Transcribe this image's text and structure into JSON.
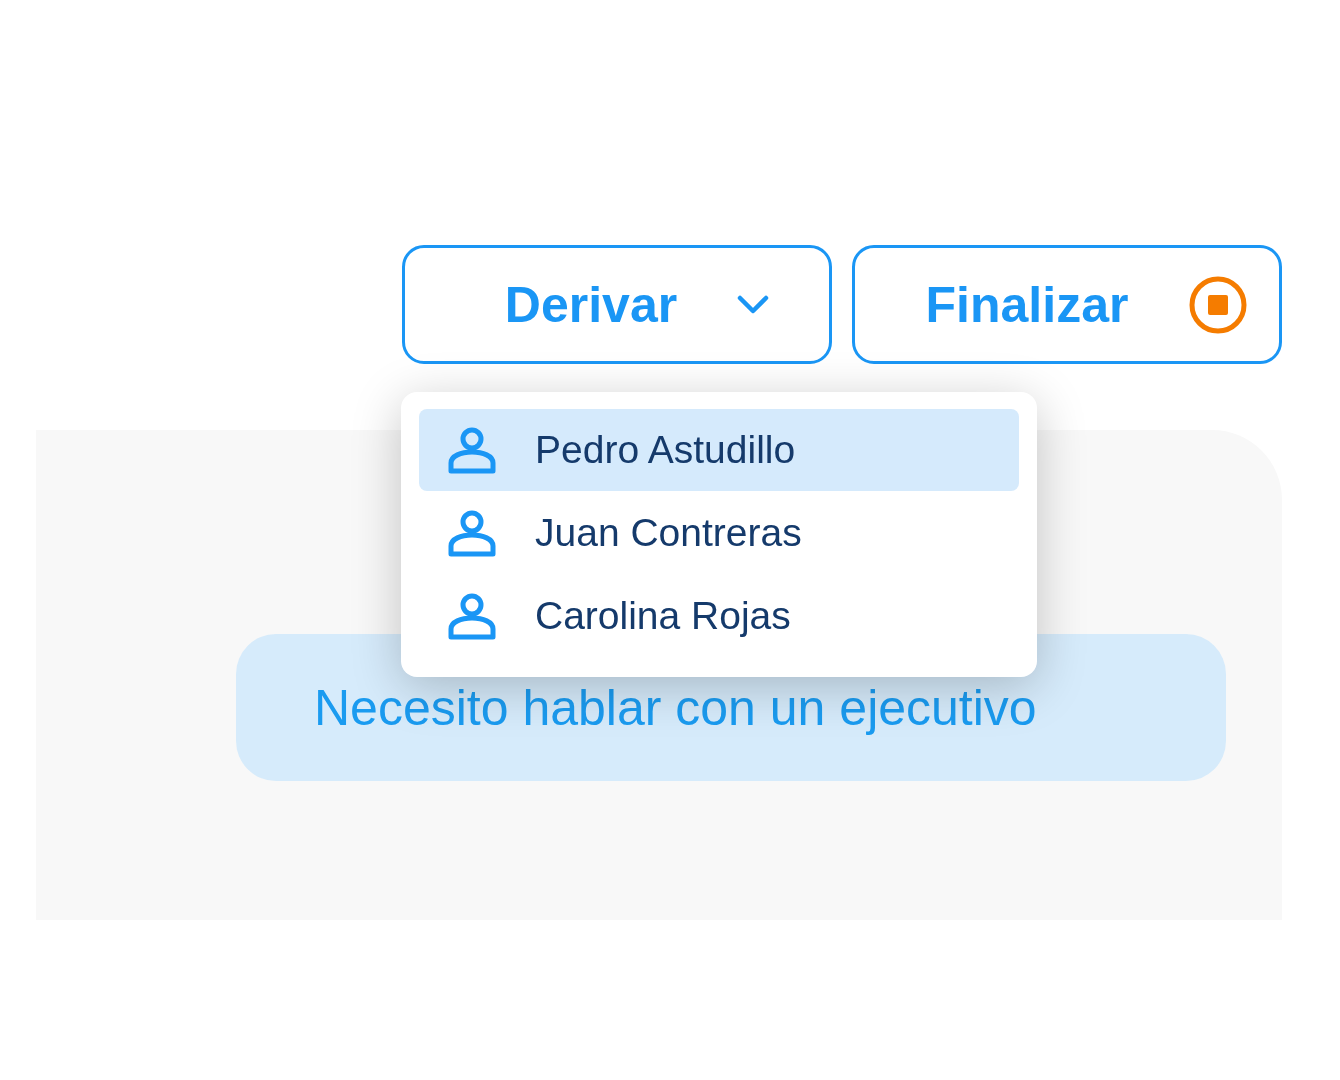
{
  "actions": [
    {
      "kind": "dropdown",
      "label": "Derivar",
      "expanded": true
    },
    {
      "kind": "stop",
      "label": "Finalizar"
    }
  ],
  "menu": {
    "items": [
      {
        "name": "Pedro Astudillo",
        "selected": true
      },
      {
        "name": "Juan Contreras",
        "selected": false
      },
      {
        "name": "Carolina Rojas",
        "selected": false
      }
    ]
  },
  "message": {
    "text": "Necesito hablar con un ejecutivo"
  }
}
